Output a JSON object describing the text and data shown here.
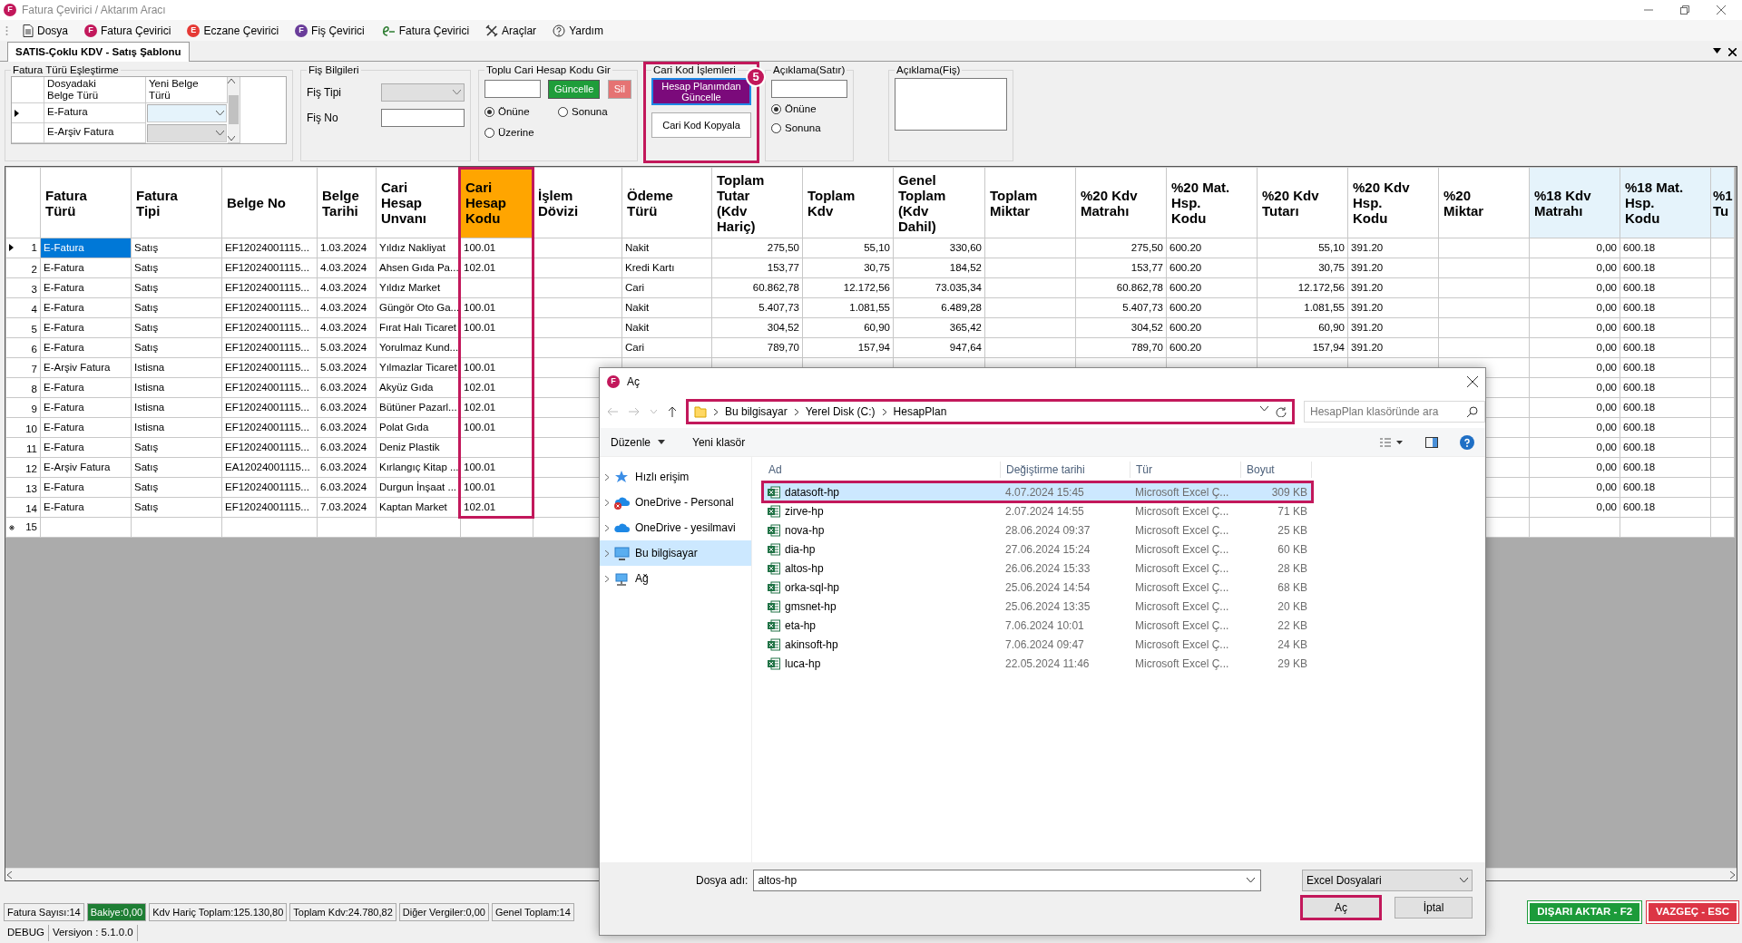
{
  "window": {
    "title": "Fatura Çevirici / Aktarım Aracı",
    "glyph": "F"
  },
  "menu": [
    {
      "label": "Dosya",
      "kind": "document"
    },
    {
      "label": "Fatura Çevirici",
      "kind": "letter",
      "glyph": "F",
      "color": "#c2185b"
    },
    {
      "label": "Eczane Çevirici",
      "kind": "letter",
      "glyph": "E",
      "color": "#e53935"
    },
    {
      "label": "Fiş Çevirici",
      "kind": "letter",
      "glyph": "F",
      "color": "#6a3d9a"
    },
    {
      "label": "Fatura Çevirici",
      "kind": "efatura"
    },
    {
      "label": "Araçlar",
      "kind": "tools"
    },
    {
      "label": "Yardım",
      "kind": "help"
    }
  ],
  "tabs": [
    {
      "label": "SATIS-Çoklu KDV - Satış Şablonu",
      "selected": true
    }
  ],
  "mapping": {
    "title": "Fatura Türü Eşleştirme",
    "columns": [
      "Dosyadaki\nBelge Türü",
      "Yeni Belge\nTürü"
    ],
    "rows": [
      {
        "source": "E-Fatura",
        "selected": true
      },
      {
        "source": "E-Arşiv Fatura",
        "selected": false
      }
    ]
  },
  "fis": {
    "title": "Fiş Bilgileri",
    "type_label": "Fiş Tipi",
    "type_disabled": true,
    "no_label": "Fiş No"
  },
  "bulk": {
    "title": "Toplu Cari Hesap Kodu Gir",
    "update_button": "Güncelle",
    "delete_button": "Sil",
    "options": [
      {
        "label": "Önüne",
        "selected": true
      },
      {
        "label": "Sonuna",
        "selected": false
      },
      {
        "label": "Üzerine",
        "selected": false
      }
    ]
  },
  "cari": {
    "title": "Cari Kod İşlemleri",
    "annotated": true,
    "step": "5",
    "buttons": [
      {
        "label": "Hesap Planımdan\nGüncelle",
        "kind": "primary"
      },
      {
        "label": "Cari Kod Kopyala",
        "kind": "default"
      }
    ]
  },
  "line_note": {
    "title": "Açıklama(Satır)",
    "options": [
      {
        "label": "Önüne",
        "selected": true
      },
      {
        "label": "Sonuna",
        "selected": false
      }
    ]
  },
  "doc_note": {
    "title": "Açıklama(Fiş)"
  },
  "grid": {
    "columns": [
      {
        "label": "Fatura\nTürü",
        "kind": "text",
        "highlighted": false,
        "annotated": false
      },
      {
        "label": "Fatura\nTipi",
        "kind": "text",
        "highlighted": false,
        "annotated": false
      },
      {
        "label": "Belge No",
        "kind": "text",
        "highlighted": false,
        "annotated": false
      },
      {
        "label": "Belge\nTarihi",
        "kind": "text",
        "highlighted": false,
        "annotated": false
      },
      {
        "label": "Cari\nHesap\nUnvanı",
        "kind": "text",
        "highlighted": false,
        "annotated": false
      },
      {
        "label": "Cari\nHesap\nKodu",
        "kind": "text",
        "highlighted": false,
        "annotated": true
      },
      {
        "label": "İşlem\nDövizi",
        "kind": "text",
        "highlighted": false,
        "annotated": false
      },
      {
        "label": "Ödeme\nTürü",
        "kind": "text",
        "highlighted": false,
        "annotated": false
      },
      {
        "label": "Toplam\nTutar\n(Kdv\nHariç)",
        "kind": "amount",
        "highlighted": false,
        "annotated": false
      },
      {
        "label": "Toplam\nKdv",
        "kind": "amount",
        "highlighted": false,
        "annotated": false
      },
      {
        "label": "Genel\nToplam\n(Kdv\nDahil)",
        "kind": "amount",
        "highlighted": false,
        "annotated": false
      },
      {
        "label": "Toplam\nMiktar",
        "kind": "amount",
        "highlighted": false,
        "annotated": false
      },
      {
        "label": "%20 Kdv\nMatrahı",
        "kind": "amount",
        "highlighted": false,
        "annotated": false
      },
      {
        "label": "%20 Mat.\nHsp.\nKodu",
        "kind": "text",
        "highlighted": false,
        "annotated": false
      },
      {
        "label": "%20 Kdv\nTutarı",
        "kind": "amount",
        "highlighted": false,
        "annotated": false
      },
      {
        "label": "%20 Kdv\nHsp.\nKodu",
        "kind": "text",
        "highlighted": false,
        "annotated": false
      },
      {
        "label": "%20\nMiktar",
        "kind": "amount",
        "highlighted": false,
        "annotated": false
      },
      {
        "label": "%18 Kdv\nMatrahı",
        "kind": "amount",
        "highlighted": true,
        "annotated": false
      },
      {
        "label": "%18 Mat.\nHsp.\nKodu",
        "kind": "text",
        "highlighted": true,
        "annotated": false
      },
      {
        "label": "%1\nTu",
        "kind": "amount",
        "highlighted": true,
        "annotated": false
      }
    ],
    "rows": [
      {
        "num": "1",
        "kind": "current",
        "selected": true,
        "cells": [
          "E-Fatura",
          "Satış",
          "EF12024001115...",
          "1.03.2024",
          "Yıldız Nakliyat",
          "100.01",
          null,
          "Nakit",
          "275,50",
          "55,10",
          "330,60",
          null,
          "275,50",
          "600.20",
          "55,10",
          "391.20",
          null,
          "0,00",
          "600.18",
          null
        ]
      },
      {
        "num": "2",
        "kind": "data",
        "selected": false,
        "cells": [
          "E-Fatura",
          "Satış",
          "EF12024001115...",
          "4.03.2024",
          "Ahsen Gıda Pa...",
          "102.01",
          null,
          "Kredi Kartı",
          "153,77",
          "30,75",
          "184,52",
          null,
          "153,77",
          "600.20",
          "30,75",
          "391.20",
          null,
          "0,00",
          "600.18",
          null
        ]
      },
      {
        "num": "3",
        "kind": "data",
        "selected": false,
        "cells": [
          "E-Fatura",
          "Satış",
          "EF12024001115...",
          "4.03.2024",
          "Yıldız Market",
          null,
          null,
          "Cari",
          "60.862,78",
          "12.172,56",
          "73.035,34",
          null,
          "60.862,78",
          "600.20",
          "12.172,56",
          "391.20",
          null,
          "0,00",
          "600.18",
          null
        ]
      },
      {
        "num": "4",
        "kind": "data",
        "selected": false,
        "cells": [
          "E-Fatura",
          "Satış",
          "EF12024001115...",
          "4.03.2024",
          "Güngör Oto Ga...",
          "100.01",
          null,
          "Nakit",
          "5.407,73",
          "1.081,55",
          "6.489,28",
          null,
          "5.407,73",
          "600.20",
          "1.081,55",
          "391.20",
          null,
          "0,00",
          "600.18",
          null
        ]
      },
      {
        "num": "5",
        "kind": "data",
        "selected": false,
        "cells": [
          "E-Fatura",
          "Satış",
          "EF12024001115...",
          "4.03.2024",
          "Fırat Halı Ticaret",
          "100.01",
          null,
          "Nakit",
          "304,52",
          "60,90",
          "365,42",
          null,
          "304,52",
          "600.20",
          "60,90",
          "391.20",
          null,
          "0,00",
          "600.18",
          null
        ]
      },
      {
        "num": "6",
        "kind": "data",
        "selected": false,
        "cells": [
          "E-Fatura",
          "Satış",
          "EF12024001115...",
          "5.03.2024",
          "Yorulmaz Kund...",
          null,
          null,
          "Cari",
          "789,70",
          "157,94",
          "947,64",
          null,
          "789,70",
          "600.20",
          "157,94",
          "391.20",
          null,
          "0,00",
          "600.18",
          null
        ]
      },
      {
        "num": "7",
        "kind": "data",
        "selected": false,
        "cells": [
          "E-Arşiv Fatura",
          "Istisna",
          "EF12024001115...",
          "5.03.2024",
          "Yılmazlar Ticaret",
          "100.01",
          null,
          null,
          null,
          null,
          null,
          null,
          null,
          null,
          null,
          null,
          null,
          "0,00",
          "600.18",
          null
        ]
      },
      {
        "num": "8",
        "kind": "data",
        "selected": false,
        "cells": [
          "E-Fatura",
          "Istisna",
          "EF12024001115...",
          "6.03.2024",
          "Akyüz Gıda",
          "102.01",
          null,
          null,
          null,
          null,
          null,
          null,
          null,
          null,
          null,
          null,
          null,
          "0,00",
          "600.18",
          null
        ]
      },
      {
        "num": "9",
        "kind": "data",
        "selected": false,
        "cells": [
          "E-Fatura",
          "Istisna",
          "EF12024001115...",
          "6.03.2024",
          "Bütüner Pazarl...",
          "102.01",
          null,
          null,
          null,
          null,
          null,
          null,
          null,
          null,
          null,
          null,
          null,
          "0,00",
          "600.18",
          null
        ]
      },
      {
        "num": "10",
        "kind": "data",
        "selected": false,
        "cells": [
          "E-Fatura",
          "Istisna",
          "EF12024001115...",
          "6.03.2024",
          "Polat Gıda",
          "100.01",
          null,
          null,
          null,
          null,
          null,
          null,
          null,
          null,
          null,
          null,
          null,
          "0,00",
          "600.18",
          null
        ]
      },
      {
        "num": "11",
        "kind": "data",
        "selected": false,
        "cells": [
          "E-Fatura",
          "Satış",
          "EF12024001115...",
          "6.03.2024",
          "Deniz Plastik",
          null,
          null,
          null,
          null,
          null,
          null,
          null,
          null,
          null,
          null,
          null,
          null,
          "0,00",
          "600.18",
          null
        ]
      },
      {
        "num": "12",
        "kind": "data",
        "selected": false,
        "cells": [
          "E-Arşiv Fatura",
          "Satış",
          "EA12024001115...",
          "6.03.2024",
          "Kırlangıç Kitap ...",
          "100.01",
          null,
          null,
          null,
          null,
          null,
          null,
          null,
          null,
          null,
          null,
          null,
          "0,00",
          "600.18",
          null
        ]
      },
      {
        "num": "13",
        "kind": "data",
        "selected": false,
        "cells": [
          "E-Fatura",
          "Satış",
          "EF12024001115...",
          "6.03.2024",
          "Durgun İnşaat ...",
          "100.01",
          null,
          null,
          null,
          null,
          null,
          null,
          null,
          null,
          null,
          null,
          null,
          "0,00",
          "600.18",
          null
        ]
      },
      {
        "num": "14",
        "kind": "data",
        "selected": false,
        "cells": [
          "E-Fatura",
          "Satış",
          "EF12024001115...",
          "7.03.2024",
          "Kaptan Market",
          "102.01",
          null,
          null,
          null,
          null,
          null,
          null,
          null,
          null,
          null,
          null,
          null,
          "0,00",
          "600.18",
          null
        ]
      },
      {
        "num": "15",
        "kind": "new",
        "selected": false,
        "cells": []
      }
    ]
  },
  "status": [
    {
      "text": "Fatura Sayısı:14",
      "kind": "plain"
    },
    {
      "text": "Bakiye:0,00",
      "kind": "ok"
    },
    {
      "text": "Kdv Hariç Toplam:125.130,80",
      "kind": "plain"
    },
    {
      "text": "Toplam Kdv:24.780,82",
      "kind": "plain"
    },
    {
      "text": "Diğer Vergiler:0,00",
      "kind": "plain"
    },
    {
      "text": "Genel Toplam:14",
      "kind": "plain"
    }
  ],
  "actions": [
    {
      "label": "DIŞARI AKTAR - F2",
      "kind": "export"
    },
    {
      "label": "VAZGEÇ - ESC",
      "kind": "cancel"
    }
  ],
  "footer": [
    "DEBUG",
    "Versiyon : 5.1.0.0"
  ],
  "dialog": {
    "title": "Aç",
    "glyph": "F",
    "path": [
      "Bu bilgisayar",
      "Yerel Disk (C:)",
      "HesapPlan"
    ],
    "path_annotated": true,
    "search": {
      "placeholder": "HesapPlan klasöründe ara"
    },
    "toolbar": [
      "Düzenle",
      "Yeni klasör"
    ],
    "nav": [
      {
        "label": "Hızlı erişim",
        "kind": "star",
        "selected": false
      },
      {
        "label": "OneDrive - Personal",
        "kind": "cloud-error",
        "selected": false
      },
      {
        "label": "OneDrive - yesilmavi",
        "kind": "cloud",
        "selected": false
      },
      {
        "label": "Bu bilgisayar",
        "kind": "computer",
        "selected": true
      },
      {
        "label": "Ağ",
        "kind": "network",
        "selected": false
      }
    ],
    "columns": [
      "Ad",
      "Değiştirme tarihi",
      "Tür",
      "Boyut"
    ],
    "files": [
      {
        "name": "datasoft-hp",
        "modified": "4.07.2024 15:45",
        "type": "Microsoft Excel Ç...",
        "size": "309 KB",
        "selected": true,
        "annotated": true
      },
      {
        "name": "zirve-hp",
        "modified": "2.07.2024 14:55",
        "type": "Microsoft Excel Ç...",
        "size": "71 KB",
        "selected": false,
        "annotated": false
      },
      {
        "name": "nova-hp",
        "modified": "28.06.2024 09:37",
        "type": "Microsoft Excel Ç...",
        "size": "25 KB",
        "selected": false,
        "annotated": false
      },
      {
        "name": "dia-hp",
        "modified": "27.06.2024 15:24",
        "type": "Microsoft Excel Ç...",
        "size": "60 KB",
        "selected": false,
        "annotated": false
      },
      {
        "name": "altos-hp",
        "modified": "26.06.2024 15:33",
        "type": "Microsoft Excel Ç...",
        "size": "28 KB",
        "selected": false,
        "annotated": false
      },
      {
        "name": "orka-sql-hp",
        "modified": "25.06.2024 14:54",
        "type": "Microsoft Excel Ç...",
        "size": "68 KB",
        "selected": false,
        "annotated": false
      },
      {
        "name": "gmsnet-hp",
        "modified": "25.06.2024 13:35",
        "type": "Microsoft Excel Ç...",
        "size": "20 KB",
        "selected": false,
        "annotated": false
      },
      {
        "name": "eta-hp",
        "modified": "7.06.2024 10:01",
        "type": "Microsoft Excel Ç...",
        "size": "22 KB",
        "selected": false,
        "annotated": false
      },
      {
        "name": "akinsoft-hp",
        "modified": "7.06.2024 09:47",
        "type": "Microsoft Excel Ç...",
        "size": "24 KB",
        "selected": false,
        "annotated": false
      },
      {
        "name": "luca-hp",
        "modified": "22.05.2024 11:46",
        "type": "Microsoft Excel Ç...",
        "size": "29 KB",
        "selected": false,
        "annotated": false
      }
    ],
    "filename_label": "Dosya adı:",
    "filename": "altos-hp",
    "filter": "Excel Dosyalari",
    "buttons": [
      {
        "label": "Aç",
        "kind": "open",
        "annotated": true
      },
      {
        "label": "İptal",
        "kind": "cancel",
        "annotated": false
      }
    ]
  }
}
